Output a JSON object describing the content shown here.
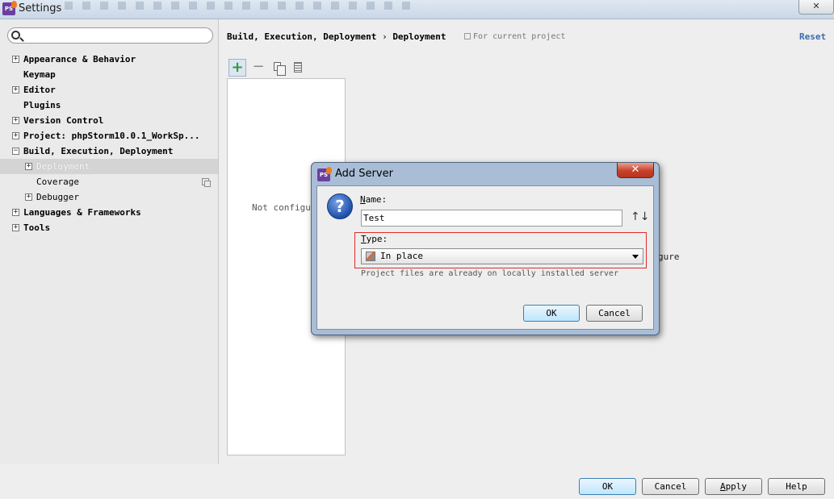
{
  "window": {
    "title": "Settings",
    "icon": "phpstorm-icon",
    "close_glyph": "✕"
  },
  "search": {
    "value": "",
    "placeholder": ""
  },
  "tree": [
    {
      "label": "Appearance & Behavior",
      "expander": "+"
    },
    {
      "label": "Keymap",
      "expander": ""
    },
    {
      "label": "Editor",
      "expander": "+"
    },
    {
      "label": "Plugins",
      "expander": ""
    },
    {
      "label": "Version Control",
      "expander": "+"
    },
    {
      "label": "Project: phpStorm10.0.1_WorkSp...",
      "expander": "+"
    },
    {
      "label": "Build, Execution, Deployment",
      "expander": "−"
    },
    {
      "label": "Deployment",
      "expander": "+",
      "selected": true
    },
    {
      "label": "Coverage",
      "expander": ""
    },
    {
      "label": "Debugger",
      "expander": "+"
    },
    {
      "label": "Languages & Frameworks",
      "expander": "+"
    },
    {
      "label": "Tools",
      "expander": "+"
    }
  ],
  "breadcrumb": {
    "parent": "Build, Execution, Deployment",
    "separator": "›",
    "current": "Deployment"
  },
  "scope_note": "For current project",
  "reset_label": "Reset",
  "toolbar": {
    "add": "+",
    "remove": "−"
  },
  "server_list": {
    "empty_text": "Not configur"
  },
  "configure_hint": "gure",
  "dialog": {
    "title": "Add Server",
    "close_glyph": "✕",
    "help_glyph": "?",
    "name_label": "Name:",
    "name_value": "Test",
    "sort_glyph": "↑↓",
    "type_label": "Type:",
    "type_value": "In place",
    "type_description": "Project files are already on locally installed server",
    "ok_label": "OK",
    "cancel_label": "Cancel"
  },
  "footer": {
    "ok": "OK",
    "cancel": "Cancel",
    "apply": "Apply",
    "help": "Help"
  }
}
